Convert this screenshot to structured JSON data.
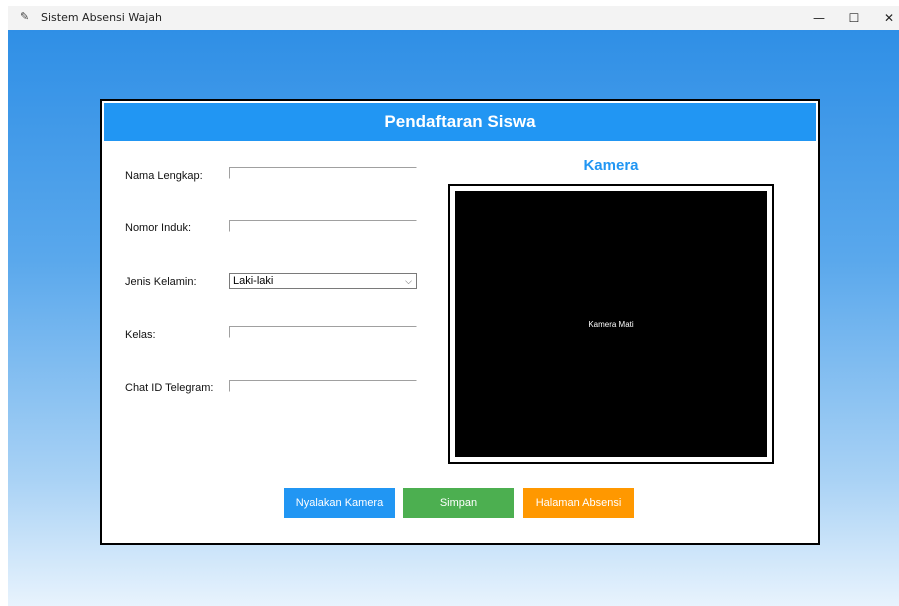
{
  "window": {
    "title": "Sistem Absensi Wajah",
    "icon": "feather-icon",
    "controls": {
      "minimize": "—",
      "maximize": "☐",
      "close": "✕"
    }
  },
  "form": {
    "header": "Pendaftaran Siswa",
    "fields": {
      "nama_label": "Nama Lengkap:",
      "nama_value": "",
      "nomor_label": "Nomor Induk:",
      "nomor_value": "",
      "gender_label": "Jenis Kelamin:",
      "gender_value": "Laki-laki",
      "kelas_label": "Kelas:",
      "kelas_value": "",
      "chat_label": "Chat ID Telegram:",
      "chat_value": ""
    }
  },
  "camera": {
    "title": "Kamera",
    "status": "Kamera Mati"
  },
  "buttons": {
    "camera_on": "Nyalakan Kamera",
    "save": "Simpan",
    "attendance": "Halaman Absensi"
  },
  "colors": {
    "primary": "#2196f3",
    "save": "#4caf50",
    "attendance": "#ff9800"
  }
}
